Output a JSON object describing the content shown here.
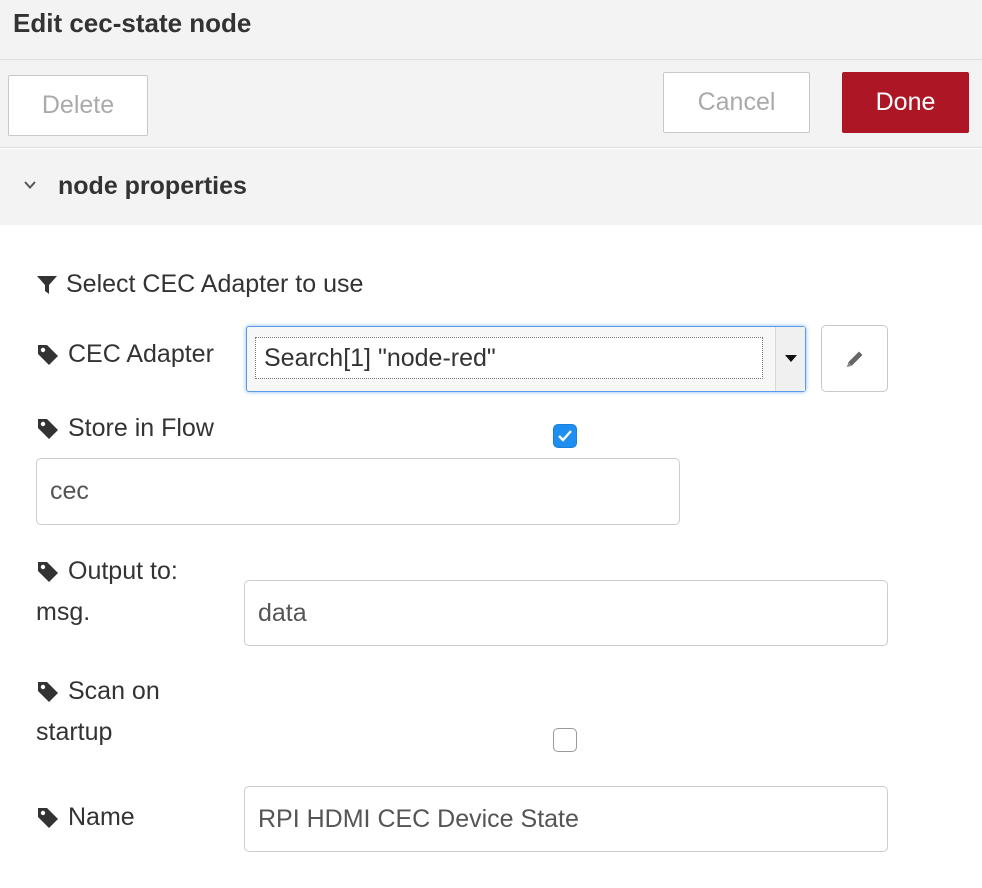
{
  "header": {
    "title": "Edit cec-state node"
  },
  "toolbar": {
    "delete_label": "Delete",
    "cancel_label": "Cancel",
    "done_label": "Done",
    "done_color": "#ad1625"
  },
  "section": {
    "title": "node properties"
  },
  "form": {
    "filter_label": "Select CEC Adapter to use",
    "adapter": {
      "label": "CEC Adapter",
      "selected": "Search[1] \"node-red\""
    },
    "store_in_flow": {
      "label": "Store in Flow",
      "checked": true,
      "value": "cec"
    },
    "output": {
      "label_line1": "Output to:",
      "label_line2": "msg.",
      "value": "data"
    },
    "scan_on_startup": {
      "label_line1": "Scan on",
      "label_line2": "startup",
      "checked": false
    },
    "name": {
      "label": "Name",
      "value": "RPI HDMI CEC Device State"
    }
  },
  "icons": {
    "filter": "filter-icon",
    "tag": "tag-icon",
    "pencil": "pencil-icon",
    "chevron": "chevron-down-icon",
    "caret": "caret-down-icon",
    "check": "check-icon"
  }
}
